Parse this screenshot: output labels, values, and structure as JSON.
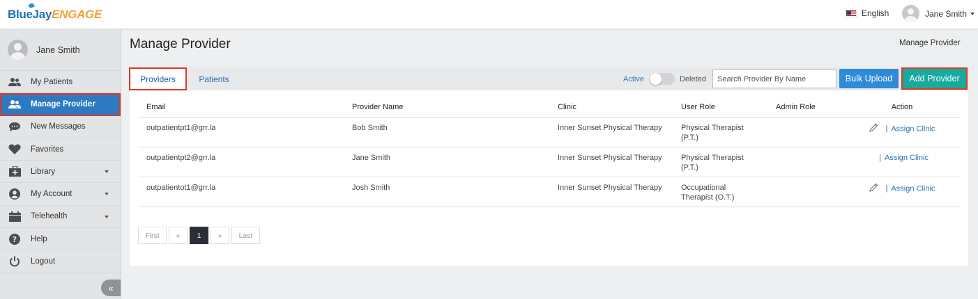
{
  "header": {
    "logo_blue": "BlueJay",
    "logo_orange": "ENGAGE",
    "language": "English",
    "user_name": "Jane Smith"
  },
  "sidebar": {
    "profile_name": "Jane Smith",
    "items": [
      {
        "label": "My Patients",
        "icon": "users-icon"
      },
      {
        "label": "Manage Provider",
        "icon": "users-icon"
      },
      {
        "label": "New Messages",
        "icon": "chat-icon"
      },
      {
        "label": "Favorites",
        "icon": "heart-icon"
      },
      {
        "label": "Library",
        "icon": "medical-kit-icon"
      },
      {
        "label": "My Account",
        "icon": "user-circle-icon"
      },
      {
        "label": "Telehealth",
        "icon": "calendar-icon"
      },
      {
        "label": "Help",
        "icon": "question-icon"
      },
      {
        "label": "Logout",
        "icon": "power-icon"
      }
    ],
    "collapse_glyph": "«"
  },
  "main": {
    "title": "Manage Provider",
    "breadcrumb": "Manage Provider",
    "tabs": [
      "Providers",
      "Patients"
    ],
    "toggle": {
      "active_label": "Active",
      "deleted_label": "Deleted"
    },
    "search_placeholder": "Search Provider By Name",
    "bulk_upload": "Bulk Upload",
    "add_provider": "Add Provider",
    "table": {
      "headers": [
        "Email",
        "Provider Name",
        "Clinic",
        "User Role",
        "Admin Role",
        "Action"
      ],
      "rows": [
        {
          "email": "outpatientpt1@grr.la",
          "name": "Bob Smith",
          "clinic": "Inner Sunset Physical Therapy",
          "role_line1": "Physical Therapist",
          "role_line2": "(P.T.)",
          "admin_role": "",
          "sep": "|",
          "assign": "Assign Clinic"
        },
        {
          "email": "outpatientpt2@grr.la",
          "name": "Jane Smith",
          "clinic": "Inner Sunset Physical Therapy",
          "role_line1": "Physical Therapist",
          "role_line2": "(P.T.)",
          "admin_role": "",
          "sep": "|",
          "assign": "Assign Clinic"
        },
        {
          "email": "outpatientot1@grr.la",
          "name": "Josh Smith",
          "clinic": "Inner Sunset Physical Therapy",
          "role_line1": "Occupational",
          "role_line2": "Therapist (O.T.)",
          "admin_role": "",
          "sep": "|",
          "assign": "Assign Clinic"
        }
      ]
    },
    "pagination": {
      "first": "First",
      "prev": "«",
      "current": "1",
      "next": "»",
      "last": "Last"
    }
  }
}
